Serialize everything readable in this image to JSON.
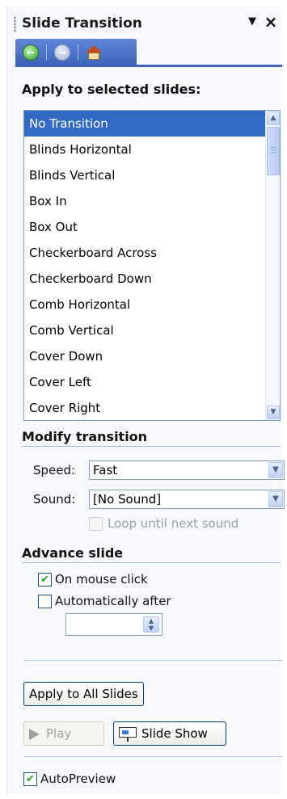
{
  "pane": {
    "title": "Slide Transition",
    "menu_glyph": "▼",
    "close_glyph": "×"
  },
  "nav": {
    "back_icon": "back-arrow-icon",
    "forward_icon": "forward-arrow-icon",
    "home_icon": "home-icon"
  },
  "apply_section": {
    "heading": "Apply to selected slides:",
    "selected": "No Transition",
    "items": [
      "No Transition",
      "Blinds Horizontal",
      "Blinds Vertical",
      "Box In",
      "Box Out",
      "Checkerboard Across",
      "Checkerboard Down",
      "Comb Horizontal",
      "Comb Vertical",
      "Cover Down",
      "Cover Left",
      "Cover Right"
    ]
  },
  "modify": {
    "heading": "Modify transition",
    "speed_label": "Speed:",
    "speed_value": "Fast",
    "sound_label": "Sound:",
    "sound_value": "[No Sound]",
    "loop_label": "Loop until next sound",
    "loop_checked": false
  },
  "advance": {
    "heading": "Advance slide",
    "mouse_click_label": "On mouse click",
    "mouse_click_checked": true,
    "auto_label": "Automatically after",
    "auto_checked": false,
    "auto_value": ""
  },
  "buttons": {
    "apply_all": "Apply to All Slides",
    "play": "Play",
    "slide_show": "Slide Show"
  },
  "autopreview": {
    "label": "AutoPreview",
    "checked": true
  },
  "glyphs": {
    "check": "✔",
    "arrow_up": "▲",
    "arrow_down": "▼"
  }
}
